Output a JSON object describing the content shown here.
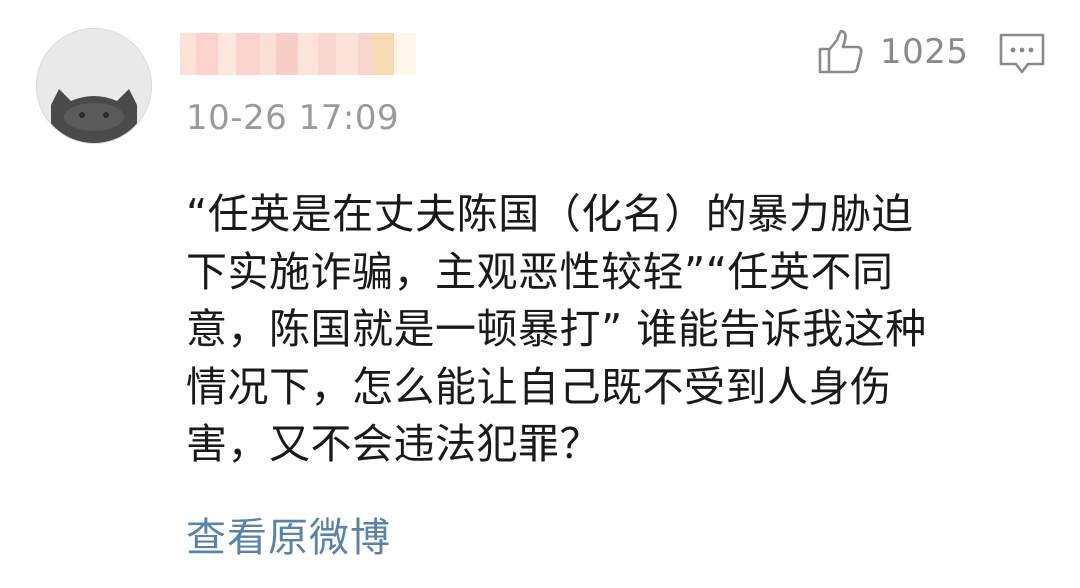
{
  "comment": {
    "timestamp": "10-26 17:09",
    "like_count": "1025",
    "body": "“任英是在丈夫陈国（化名）的暴力胁迫\n下实施诈骗，主观恶性较轻”“任英不同\n意，陈国就是一顿暴打” 谁能告诉我这种\n情况下，怎么能让自己既不受到人身伤\n害，又不会违法犯罪？",
    "view_original_label": "查看原微博"
  }
}
